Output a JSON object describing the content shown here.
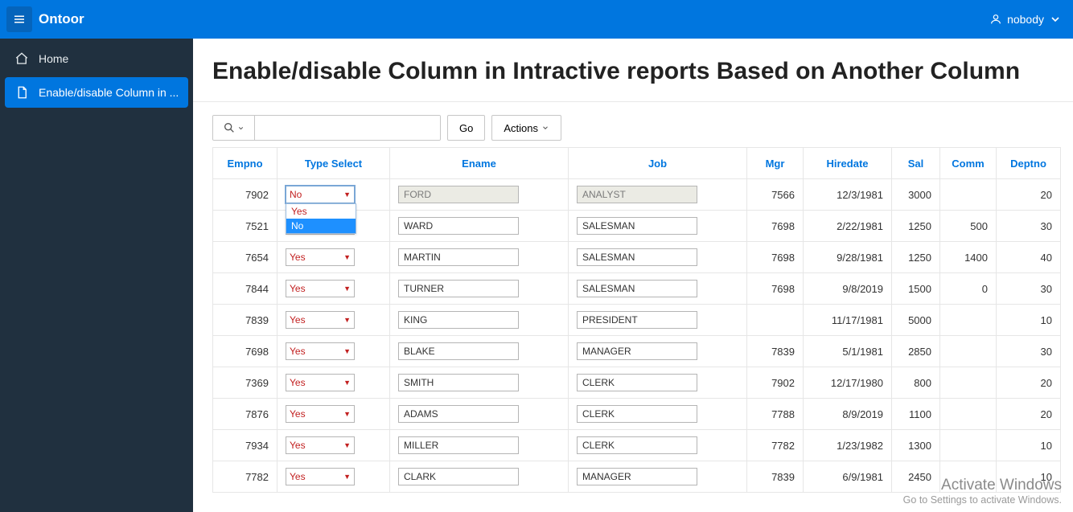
{
  "header": {
    "brand": "Ontoor",
    "user_label": "nobody"
  },
  "sidebar": {
    "items": [
      {
        "label": "Home",
        "selected": false
      },
      {
        "label": "Enable/disable Column in ...",
        "selected": true
      }
    ]
  },
  "page": {
    "title": "Enable/disable Column in Intractive reports Based on Another Column"
  },
  "toolbar": {
    "go_label": "Go",
    "actions_label": "Actions"
  },
  "columns": {
    "empno": "Empno",
    "type": "Type Select",
    "ename": "Ename",
    "job": "Job",
    "mgr": "Mgr",
    "hiredate": "Hiredate",
    "sal": "Sal",
    "comm": "Comm",
    "deptno": "Deptno"
  },
  "select_options": {
    "yes": "Yes",
    "no": "No"
  },
  "rows": [
    {
      "empno": "7902",
      "type": "No",
      "ename": "FORD",
      "job": "ANALYST",
      "mgr": "7566",
      "hiredate": "12/3/1981",
      "sal": "3000",
      "comm": "",
      "deptno": "20",
      "disabled": true,
      "open_dropdown": true
    },
    {
      "empno": "7521",
      "type": "Yes",
      "ename": "WARD",
      "job": "SALESMAN",
      "mgr": "7698",
      "hiredate": "2/22/1981",
      "sal": "1250",
      "comm": "500",
      "deptno": "30",
      "disabled": false
    },
    {
      "empno": "7654",
      "type": "Yes",
      "ename": "MARTIN",
      "job": "SALESMAN",
      "mgr": "7698",
      "hiredate": "9/28/1981",
      "sal": "1250",
      "comm": "1400",
      "deptno": "40",
      "disabled": false
    },
    {
      "empno": "7844",
      "type": "Yes",
      "ename": "TURNER",
      "job": "SALESMAN",
      "mgr": "7698",
      "hiredate": "9/8/2019",
      "sal": "1500",
      "comm": "0",
      "deptno": "30",
      "disabled": false
    },
    {
      "empno": "7839",
      "type": "Yes",
      "ename": "KING",
      "job": "PRESIDENT",
      "mgr": "",
      "hiredate": "11/17/1981",
      "sal": "5000",
      "comm": "",
      "deptno": "10",
      "disabled": false
    },
    {
      "empno": "7698",
      "type": "Yes",
      "ename": "BLAKE",
      "job": "MANAGER",
      "mgr": "7839",
      "hiredate": "5/1/1981",
      "sal": "2850",
      "comm": "",
      "deptno": "30",
      "disabled": false
    },
    {
      "empno": "7369",
      "type": "Yes",
      "ename": "SMITH",
      "job": "CLERK",
      "mgr": "7902",
      "hiredate": "12/17/1980",
      "sal": "800",
      "comm": "",
      "deptno": "20",
      "disabled": false
    },
    {
      "empno": "7876",
      "type": "Yes",
      "ename": "ADAMS",
      "job": "CLERK",
      "mgr": "7788",
      "hiredate": "8/9/2019",
      "sal": "1100",
      "comm": "",
      "deptno": "20",
      "disabled": false
    },
    {
      "empno": "7934",
      "type": "Yes",
      "ename": "MILLER",
      "job": "CLERK",
      "mgr": "7782",
      "hiredate": "1/23/1982",
      "sal": "1300",
      "comm": "",
      "deptno": "10",
      "disabled": false
    },
    {
      "empno": "7782",
      "type": "Yes",
      "ename": "CLARK",
      "job": "MANAGER",
      "mgr": "7839",
      "hiredate": "6/9/1981",
      "sal": "2450",
      "comm": "",
      "deptno": "10",
      "disabled": false
    }
  ],
  "watermark": {
    "title": "Activate Windows",
    "sub": "Go to Settings to activate Windows."
  }
}
